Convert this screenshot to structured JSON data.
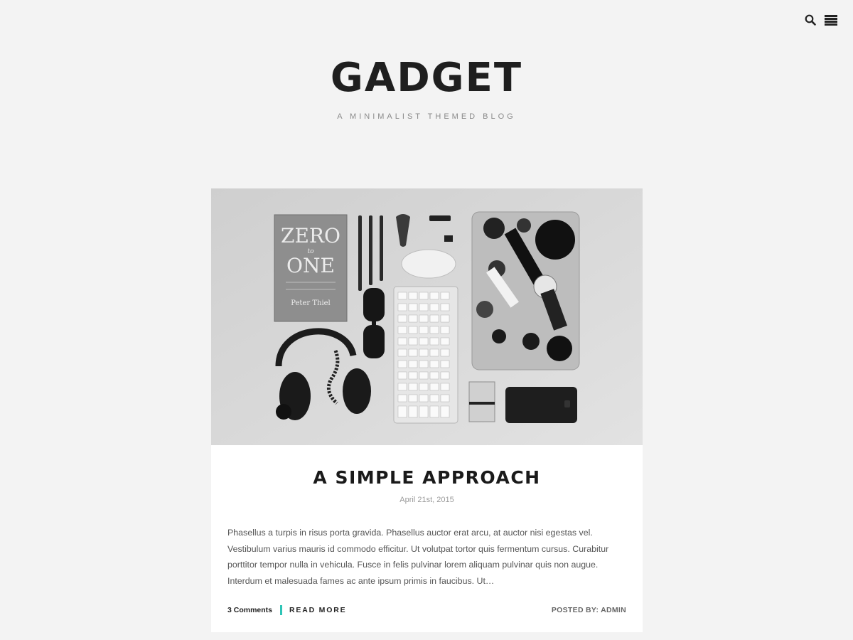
{
  "header": {
    "title": "GADGET",
    "tagline": "A MINIMALIST THEMED BLOG",
    "search_icon": "search-icon",
    "menu_icon": "hamburger-menu-icon"
  },
  "post": {
    "image_alt": "flat lay of gadgets: book, pens, headphones, sunglasses, keyboard, mouse, laptop with stickers, phone",
    "image_book_title_1": "ZERO",
    "image_book_title_2": "to",
    "image_book_title_3": "ONE",
    "image_book_author": "Peter Thiel",
    "title": "A SIMPLE APPROACH",
    "date": "April 21st, 2015",
    "excerpt": "Phasellus a turpis in risus porta gravida. Phasellus auctor erat arcu, at auctor nisi egestas vel. Vestibulum varius mauris id commodo efficitur. Ut volutpat tortor quis fermentum cursus. Curabitur porttitor tempor nulla in vehicula. Fusce in felis pulvinar lorem aliquam pulvinar quis non augue. Interdum et malesuada fames ac ante ipsum primis in faucibus. Ut…",
    "comments": "3 Comments",
    "read_more": "READ MORE",
    "posted_by": "POSTED BY: ADMIN"
  },
  "colors": {
    "background": "#f3f3f3",
    "accent": "#2ec4b6",
    "card": "#ffffff"
  }
}
